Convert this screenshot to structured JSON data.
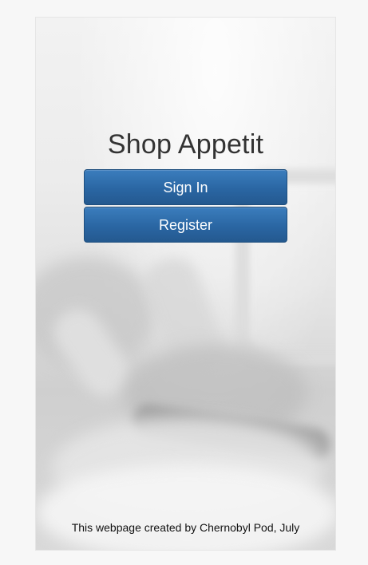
{
  "app": {
    "title": "Shop Appetit"
  },
  "actions": {
    "sign_in_label": "Sign In",
    "register_label": "Register"
  },
  "footer": {
    "text": "This webpage created by Chernobyl Pod, July"
  },
  "colors": {
    "page_background": "#f7f7f7",
    "button_primary": "#2a66a3",
    "button_border": "#1f4f7e",
    "title_text": "#333333"
  }
}
